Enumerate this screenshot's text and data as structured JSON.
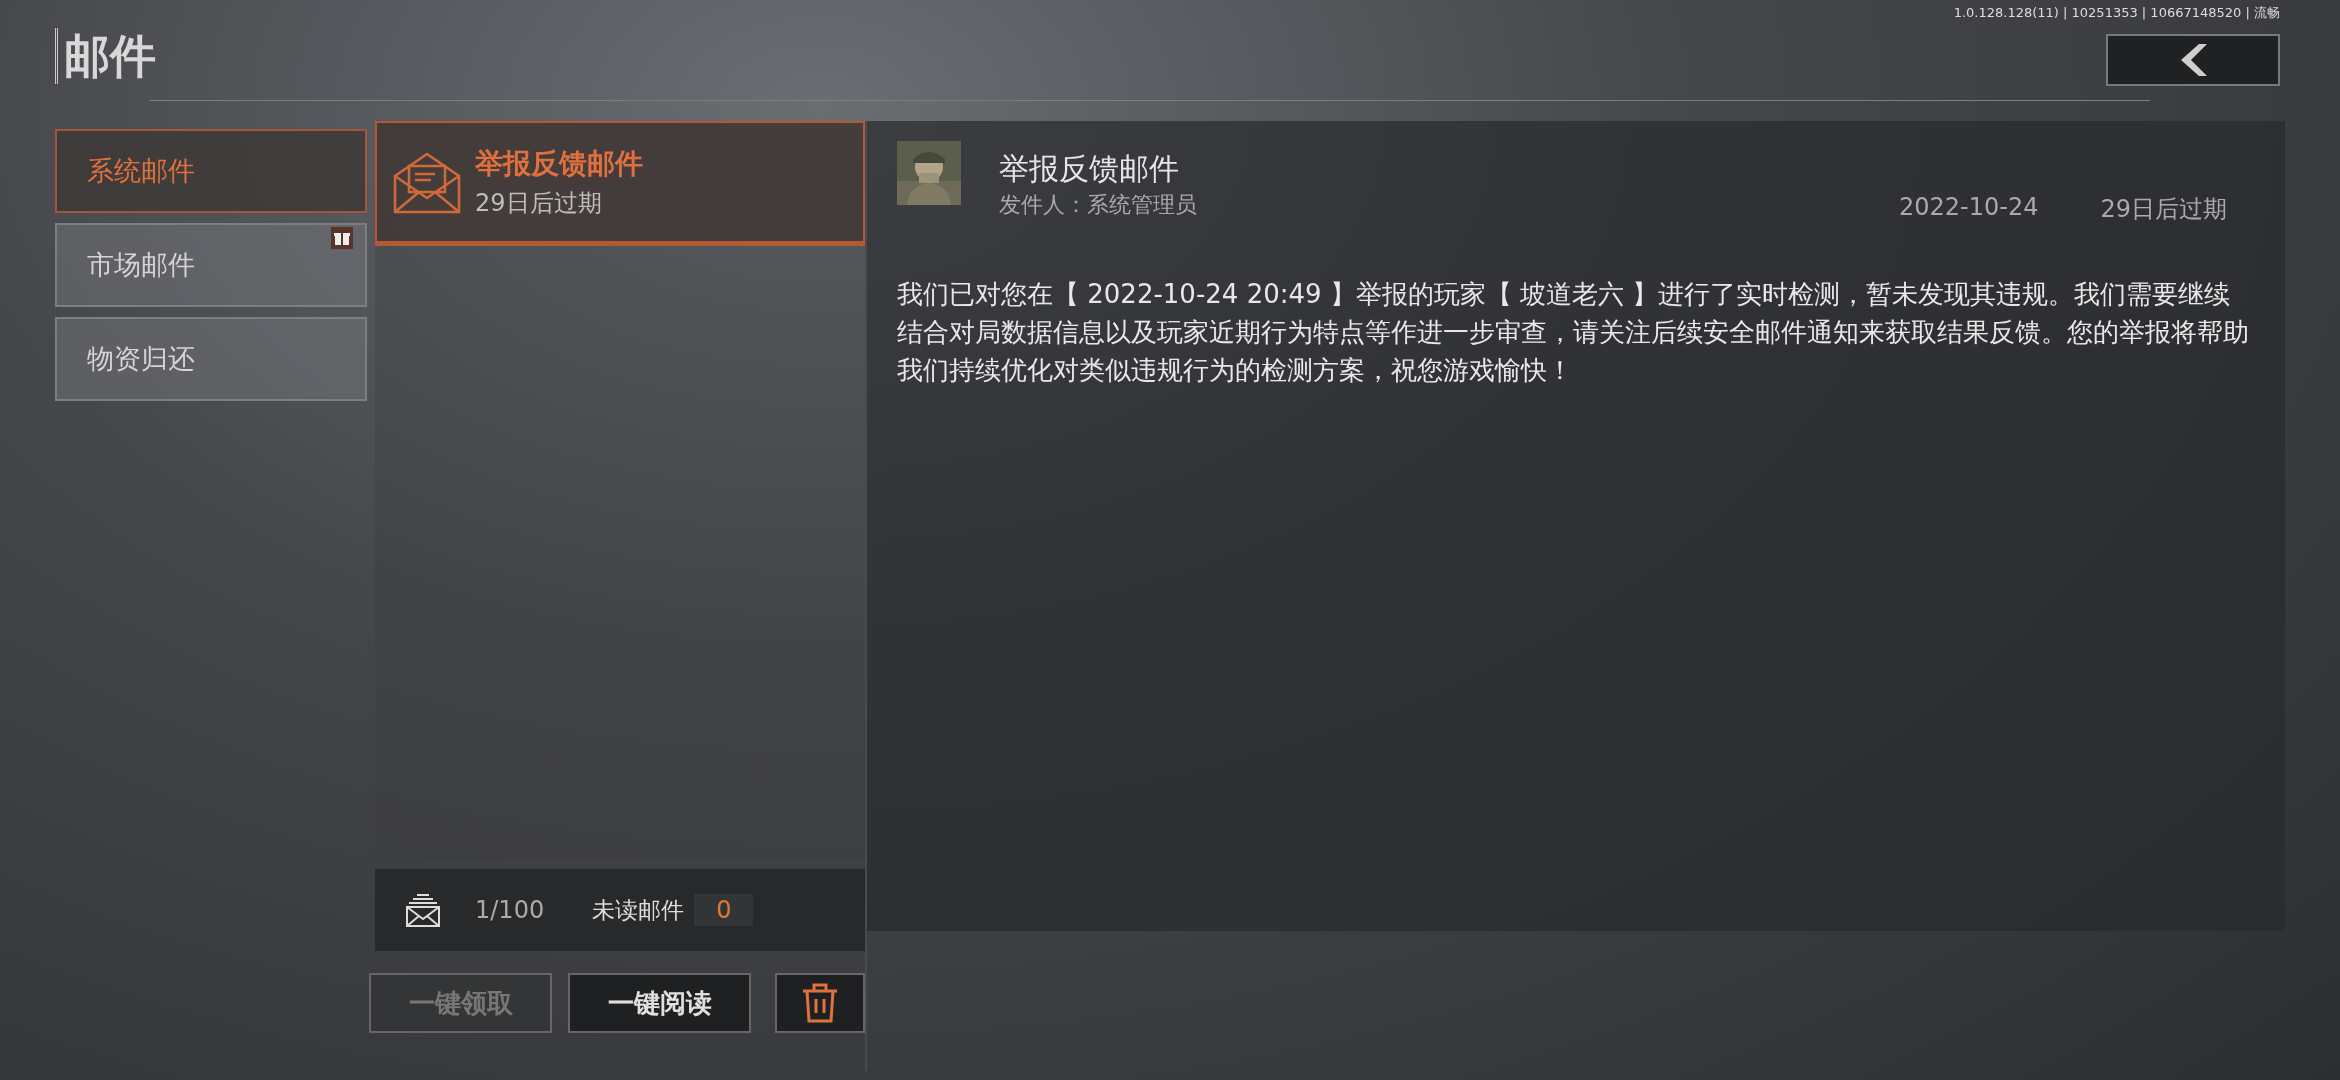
{
  "version_info": "1.0.128.128(11) | 10251353 | 10667148520 | 流畅",
  "page_title": "邮件",
  "categories": [
    {
      "label": "系统邮件",
      "selected": true,
      "gift_badge": false
    },
    {
      "label": "市场邮件",
      "selected": false,
      "gift_badge": true
    },
    {
      "label": "物资归还",
      "selected": false,
      "gift_badge": false
    }
  ],
  "mails": [
    {
      "title": "举报反馈邮件",
      "expiry": "29日后过期",
      "selected": true
    }
  ],
  "mail_stats": {
    "count": "1/100",
    "unread_label": "未读邮件",
    "unread_count": "0"
  },
  "actions": [
    {
      "kind": "text",
      "label": "一键领取",
      "disabled": true
    },
    {
      "kind": "text",
      "label": "一键阅读",
      "disabled": false
    },
    {
      "kind": "delete",
      "disabled": false
    }
  ],
  "detail": {
    "title": "举报反馈邮件",
    "sender": "发件人：系统管理员",
    "date": "2022-10-24",
    "expiry": "29日后过期",
    "body": "我们已对您在【 2022-10-24 20:49 】举报的玩家【 坡道老六 】进行了实时检测，暂未发现其违规。我们需要继续结合对局数据信息以及玩家近期行为特点等作进一步审查，请关注后续安全邮件通知来获取结果反馈。您的举报将帮助我们持续优化对类似违规行为的检测方案，祝您游戏愉快！"
  }
}
